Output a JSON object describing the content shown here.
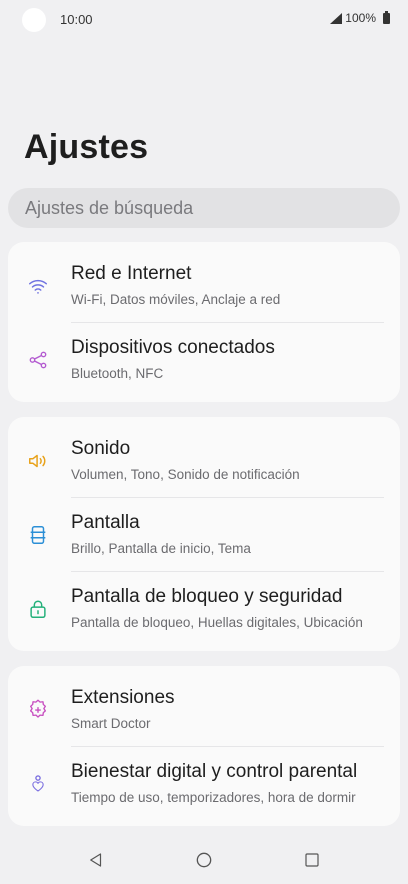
{
  "status_bar": {
    "time": "10:00",
    "battery_text": "100%"
  },
  "page": {
    "title": "Ajustes"
  },
  "search": {
    "placeholder": "Ajustes de búsqueda"
  },
  "groups": [
    {
      "items": [
        {
          "icon": "wifi-icon",
          "title": "Red e Internet",
          "subtitle": "Wi-Fi, Datos móviles, Anclaje a red",
          "color": "#6f72e0"
        },
        {
          "icon": "share-icon",
          "title": "Dispositivos conectados",
          "subtitle": "Bluetooth, NFC",
          "color": "#b35ad0"
        }
      ]
    },
    {
      "items": [
        {
          "icon": "speaker-icon",
          "title": "Sonido",
          "subtitle": "Volumen, Tono, Sonido de notificación",
          "color": "#e8a21a"
        },
        {
          "icon": "display-icon",
          "title": "Pantalla",
          "subtitle": "Brillo, Pantalla de inicio, Tema",
          "color": "#2b8fd6"
        },
        {
          "icon": "lock-icon",
          "title": "Pantalla de bloqueo y seguridad",
          "subtitle": "Pantalla de bloqueo, Huellas digitales, Ubicación",
          "color": "#24b07a"
        }
      ]
    },
    {
      "items": [
        {
          "icon": "puzzle-icon",
          "title": "Extensiones",
          "subtitle": "Smart Doctor",
          "color": "#c84fc0"
        },
        {
          "icon": "wellbeing-icon",
          "title": "Bienestar digital y control parental",
          "subtitle": "Tiempo de uso, temporizadores, hora de dormir",
          "color": "#7b6fe0"
        }
      ]
    }
  ],
  "navbar": {
    "back": "back-icon",
    "home": "home-icon",
    "recents": "recents-icon"
  }
}
